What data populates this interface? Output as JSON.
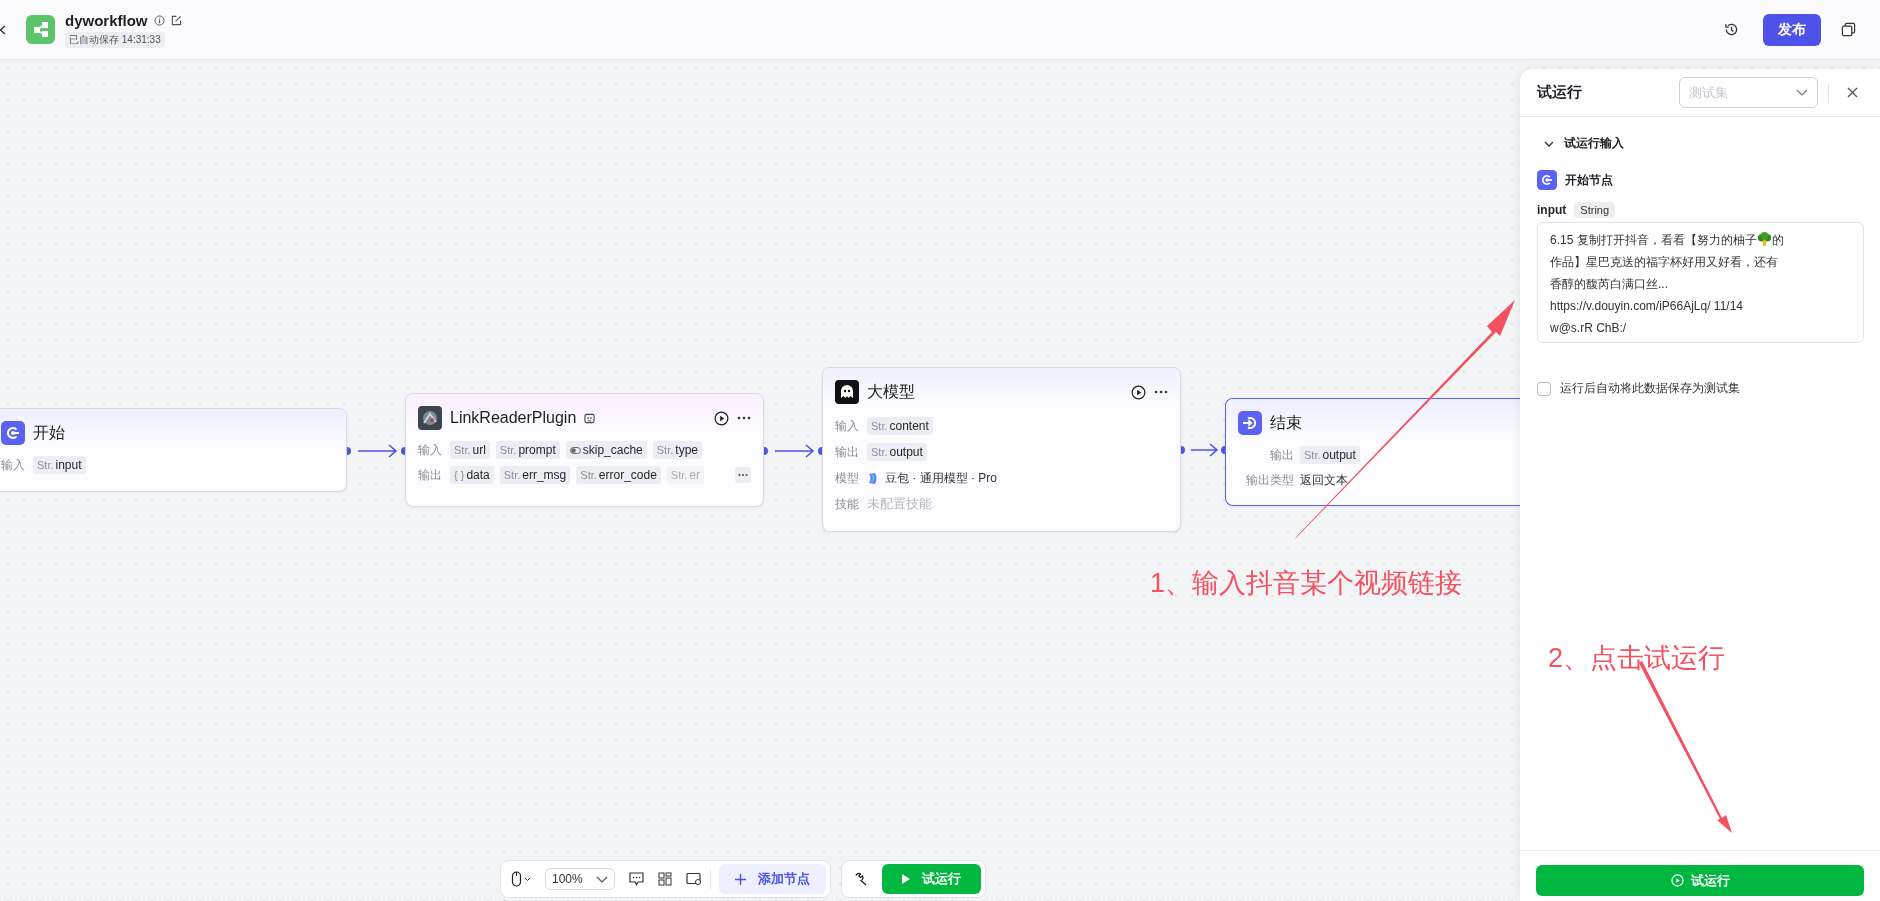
{
  "header": {
    "title": "dyworkflow",
    "autosave": "已自动保存 14:31:33",
    "publish": "发布"
  },
  "nodes": [
    {
      "kind": "start",
      "title": "开始",
      "selected": false,
      "rows": [
        {
          "kind": "tags",
          "label": "输入",
          "tags": [
            {
              "kind": "text",
              "prefix": "Str.",
              "name": "input",
              "faded": false
            }
          ]
        }
      ]
    },
    {
      "kind": "plugin",
      "title": "LinkReaderPlugin",
      "selected": false,
      "rows": [
        {
          "kind": "tags",
          "label": "输入",
          "tags": [
            {
              "kind": "text",
              "prefix": "Str.",
              "name": "url",
              "faded": false
            },
            {
              "kind": "text",
              "prefix": "Str.",
              "name": "prompt",
              "faded": false
            },
            {
              "kind": "toggle",
              "name": "skip_cache",
              "faded": false
            },
            {
              "kind": "text",
              "prefix": "Str.",
              "name": "type",
              "faded": false
            }
          ]
        },
        {
          "kind": "tags",
          "label": "输出",
          "more": true,
          "tags": [
            {
              "kind": "text",
              "prefix": "{ }",
              "name": "data",
              "faded": false
            },
            {
              "kind": "text",
              "prefix": "Str.",
              "name": "err_msg",
              "faded": false
            },
            {
              "kind": "text",
              "prefix": "Str.",
              "name": "error_code",
              "faded": false
            },
            {
              "kind": "text",
              "prefix": "Str.",
              "name": "er",
              "faded": true
            }
          ]
        }
      ]
    },
    {
      "kind": "llm",
      "title": "大模型",
      "selected": false,
      "rows": [
        {
          "kind": "tags",
          "label": "输入",
          "tags": [
            {
              "kind": "text",
              "prefix": "Str.",
              "name": "content",
              "faded": false
            }
          ]
        },
        {
          "kind": "tags",
          "label": "输出",
          "tags": [
            {
              "kind": "text",
              "prefix": "Str.",
              "name": "output",
              "faded": false
            }
          ]
        },
        {
          "kind": "model",
          "label": "模型",
          "text": "豆包 · 通用模型 · Pro",
          "muted": false
        },
        {
          "kind": "text",
          "label": "技能",
          "text": "未配置技能",
          "muted": true
        }
      ]
    },
    {
      "kind": "end",
      "title": "结束",
      "selected": true,
      "rows": [
        {
          "kind": "tags",
          "label": "输出",
          "tags": [
            {
              "kind": "text",
              "prefix": "Str.",
              "name": "output",
              "faded": false
            }
          ]
        },
        {
          "kind": "text",
          "label": "输出类型",
          "text": "返回文本",
          "muted": false
        }
      ]
    }
  ],
  "toolbar": {
    "zoom": "100%",
    "add_node": "添加节点",
    "run": "试运行"
  },
  "panel": {
    "title": "试运行",
    "testset_placeholder": "测试集",
    "section": "试运行输入",
    "expanded": true,
    "node": "开始节点",
    "field": {
      "name": "input",
      "type": "String",
      "lines": [
        [
          "6.15 复制打开抖音，看看【努力的柚子",
          "的"
        ],
        [
          "作品】星巴克送的福字杯好用又好看，还有"
        ],
        [
          "香醇的馥芮白满口丝..."
        ],
        [
          "https://v.douyin.com/iP66AjLq/ 11/14"
        ],
        [
          "w@s.rR ChB:/"
        ]
      ]
    },
    "save_checkbox": {
      "label": "运行后自动将此数据保存为测试集",
      "checked": false
    },
    "run": "试运行"
  },
  "annotations": [
    {
      "text": "1、输入抖音某个视频链接"
    },
    {
      "text": "2、点击试运行"
    }
  ]
}
